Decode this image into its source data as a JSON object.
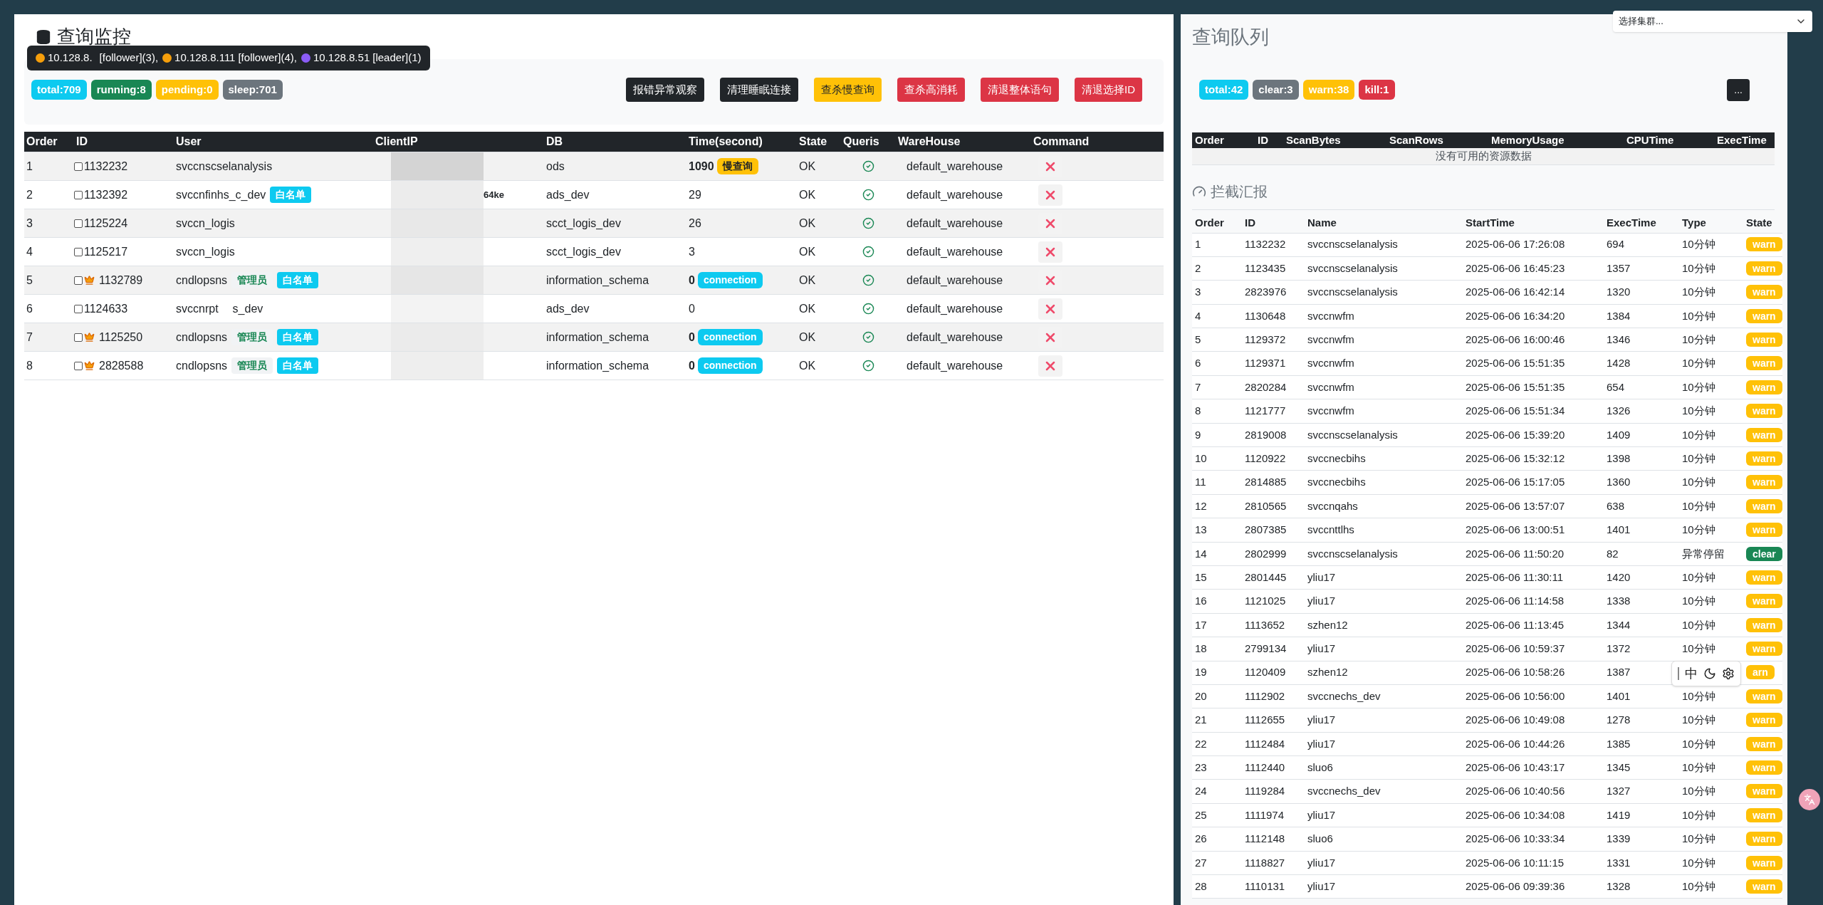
{
  "cluster_select": {
    "placeholder": "选择集群..."
  },
  "monitor": {
    "title": "查询监控",
    "tooltip": [
      {
        "host": "10.128.8.",
        "role": "[follower](3),",
        "color": "#f59e0b"
      },
      {
        "host": "10.128.8.111",
        "role": "[follower](4),",
        "color": "#f59e0b"
      },
      {
        "host": "10.128.8.51",
        "role": "[leader](1)",
        "color": "#8b5cf6"
      }
    ],
    "badges": [
      {
        "text": "total:709",
        "color": "#0dcaf0"
      },
      {
        "text": "running:8",
        "color": "#198754"
      },
      {
        "text": "pending:0",
        "color": "#ffc107"
      },
      {
        "text": "sleep:701",
        "color": "#6c757d"
      }
    ],
    "buttons": [
      {
        "label": "报错异常观察",
        "kind": "dark"
      },
      {
        "label": "清理睡眠连接",
        "kind": "dark"
      },
      {
        "label": "查杀慢查询",
        "kind": "warning"
      },
      {
        "label": "查杀高消耗",
        "kind": "danger"
      },
      {
        "label": "清退整体语句",
        "kind": "danger"
      },
      {
        "label": "清退选择ID",
        "kind": "danger"
      }
    ],
    "columns": [
      "Order",
      "ID",
      "User",
      "ClientIP",
      "DB",
      "Time(second)",
      "State",
      "Queris",
      "WareHouse",
      "Command"
    ],
    "rows": [
      {
        "order": "1",
        "id": "1132232",
        "checked": false,
        "crown": false,
        "user": "svccnscselanalysis",
        "tags": [],
        "ip_tail": "",
        "db": "ods",
        "time": "1090",
        "time_tag": {
          "text": "慢查询",
          "kind": "slow"
        },
        "state": "OK",
        "warehouse": "default_warehouse"
      },
      {
        "order": "2",
        "id": "1132392",
        "checked": false,
        "crown": false,
        "user": "svccnfinhs_c_dev",
        "tags": [
          {
            "text": "白名单",
            "kind": "whitelist"
          }
        ],
        "ip_tail": "64ke",
        "db": "ads_dev",
        "time": "29",
        "state": "OK",
        "warehouse": "default_warehouse"
      },
      {
        "order": "3",
        "id": "1125224",
        "checked": false,
        "crown": false,
        "user": "svccn_logis",
        "tags": [],
        "ip_tail": "",
        "db": "scct_logis_dev",
        "time": "26",
        "state": "OK",
        "warehouse": "default_warehouse"
      },
      {
        "order": "4",
        "id": "1125217",
        "checked": false,
        "crown": false,
        "user": "svccn_logis",
        "tags": [],
        "ip_tail": "",
        "db": "scct_logis_dev",
        "time": "3",
        "state": "OK",
        "warehouse": "default_warehouse"
      },
      {
        "order": "5",
        "id": "1132789",
        "checked": false,
        "crown": true,
        "user": "cndlopsns",
        "tags": [
          {
            "text": "管理员",
            "kind": "admin"
          },
          {
            "text": "白名单",
            "kind": "whitelist"
          }
        ],
        "ip_tail": "",
        "db": "information_schema",
        "time": "0",
        "time_tag": {
          "text": "connection",
          "kind": "connection"
        },
        "state": "OK",
        "warehouse": "default_warehouse"
      },
      {
        "order": "6",
        "id": "1124633",
        "checked": false,
        "crown": false,
        "user": "svccnrpt",
        "user_tail": "s_dev",
        "tags": [],
        "ip_tail": "",
        "db": "ads_dev",
        "time": "0",
        "state": "OK",
        "warehouse": "default_warehouse"
      },
      {
        "order": "7",
        "id": "1125250",
        "checked": false,
        "crown": true,
        "user": "cndlopsns",
        "tags": [
          {
            "text": "管理员",
            "kind": "admin"
          },
          {
            "text": "白名单",
            "kind": "whitelist"
          }
        ],
        "ip_tail": "",
        "db": "information_schema",
        "time": "0",
        "time_tag": {
          "text": "connection",
          "kind": "connection"
        },
        "state": "OK",
        "warehouse": "default_warehouse"
      },
      {
        "order": "8",
        "id": "2828588",
        "checked": false,
        "crown": true,
        "user": "cndlopsns",
        "tags": [
          {
            "text": "管理员",
            "kind": "admin"
          },
          {
            "text": "白名单",
            "kind": "whitelist"
          }
        ],
        "ip_tail": "",
        "db": "information_schema",
        "time": "0",
        "time_tag": {
          "text": "connection",
          "kind": "connection"
        },
        "state": "OK",
        "warehouse": "default_warehouse"
      }
    ]
  },
  "queue": {
    "title": "查询队列",
    "badges": [
      {
        "text": "total:42",
        "color": "#0dcaf0"
      },
      {
        "text": "clear:3",
        "color": "#6c757d"
      },
      {
        "text": "warn:38",
        "color": "#ffc107"
      },
      {
        "text": "kill:1",
        "color": "#dc3545"
      }
    ],
    "more_button": "...",
    "columns": [
      "Order",
      "ID",
      "ScanBytes",
      "ScanRows",
      "MemoryUsage",
      "CPUTime",
      "ExecTime"
    ],
    "empty_message": "没有可用的资源数据"
  },
  "report": {
    "title": "拦截汇报",
    "columns": [
      "Order",
      "ID",
      "Name",
      "StartTime",
      "ExecTime",
      "Type",
      "State"
    ],
    "rows": [
      {
        "order": "1",
        "id": "1132232",
        "name": "svccnscselanalysis",
        "start": "2025-06-06 17:26:08",
        "exec": "694",
        "type": "10分钟",
        "state": "warn",
        "kind": "warn"
      },
      {
        "order": "2",
        "id": "1123435",
        "name": "svccnscselanalysis",
        "start": "2025-06-06 16:45:23",
        "exec": "1357",
        "type": "10分钟",
        "state": "warn",
        "kind": "warn"
      },
      {
        "order": "3",
        "id": "2823976",
        "name": "svccnscselanalysis",
        "start": "2025-06-06 16:42:14",
        "exec": "1320",
        "type": "10分钟",
        "state": "warn",
        "kind": "warn"
      },
      {
        "order": "4",
        "id": "1130648",
        "name": "svccnwfm",
        "start": "2025-06-06 16:34:20",
        "exec": "1384",
        "type": "10分钟",
        "state": "warn",
        "kind": "warn"
      },
      {
        "order": "5",
        "id": "1129372",
        "name": "svccnwfm",
        "start": "2025-06-06 16:00:46",
        "exec": "1346",
        "type": "10分钟",
        "state": "warn",
        "kind": "warn"
      },
      {
        "order": "6",
        "id": "1129371",
        "name": "svccnwfm",
        "start": "2025-06-06 15:51:35",
        "exec": "1428",
        "type": "10分钟",
        "state": "warn",
        "kind": "warn"
      },
      {
        "order": "7",
        "id": "2820284",
        "name": "svccnwfm",
        "start": "2025-06-06 15:51:35",
        "exec": "654",
        "type": "10分钟",
        "state": "warn",
        "kind": "warn"
      },
      {
        "order": "8",
        "id": "1121777",
        "name": "svccnwfm",
        "start": "2025-06-06 15:51:34",
        "exec": "1326",
        "type": "10分钟",
        "state": "warn",
        "kind": "warn"
      },
      {
        "order": "9",
        "id": "2819008",
        "name": "svccnscselanalysis",
        "start": "2025-06-06 15:39:20",
        "exec": "1409",
        "type": "10分钟",
        "state": "warn",
        "kind": "warn"
      },
      {
        "order": "10",
        "id": "1120922",
        "name": "svccnecbihs",
        "start": "2025-06-06 15:32:12",
        "exec": "1398",
        "type": "10分钟",
        "state": "warn",
        "kind": "warn"
      },
      {
        "order": "11",
        "id": "2814885",
        "name": "svccnecbihs",
        "start": "2025-06-06 15:17:05",
        "exec": "1360",
        "type": "10分钟",
        "state": "warn",
        "kind": "warn"
      },
      {
        "order": "12",
        "id": "2810565",
        "name": "svccnqahs",
        "start": "2025-06-06 13:57:07",
        "exec": "638",
        "type": "10分钟",
        "state": "warn",
        "kind": "warn"
      },
      {
        "order": "13",
        "id": "2807385",
        "name": "svccnttlhs",
        "start": "2025-06-06 13:00:51",
        "exec": "1401",
        "type": "10分钟",
        "state": "warn",
        "kind": "warn"
      },
      {
        "order": "14",
        "id": "2802999",
        "name": "svccnscselanalysis",
        "start": "2025-06-06 11:50:20",
        "exec": "82",
        "type": "异常停留",
        "state": "clear",
        "kind": "clear"
      },
      {
        "order": "15",
        "id": "2801445",
        "name": "yliu17",
        "start": "2025-06-06 11:30:11",
        "exec": "1420",
        "type": "10分钟",
        "state": "warn",
        "kind": "warn"
      },
      {
        "order": "16",
        "id": "1121025",
        "name": "yliu17",
        "start": "2025-06-06 11:14:58",
        "exec": "1338",
        "type": "10分钟",
        "state": "warn",
        "kind": "warn"
      },
      {
        "order": "17",
        "id": "1113652",
        "name": "szhen12",
        "start": "2025-06-06 11:13:45",
        "exec": "1344",
        "type": "10分钟",
        "state": "warn",
        "kind": "warn"
      },
      {
        "order": "18",
        "id": "2799134",
        "name": "yliu17",
        "start": "2025-06-06 10:59:37",
        "exec": "1372",
        "type": "10分钟",
        "state": "warn",
        "kind": "warn"
      },
      {
        "order": "19",
        "id": "1120409",
        "name": "szhen12",
        "start": "2025-06-06 10:58:26",
        "exec": "1387",
        "state": "arn",
        "kind": "warn"
      },
      {
        "order": "20",
        "id": "1112902",
        "name": "svccnechs_dev",
        "start": "2025-06-06 10:56:00",
        "exec": "1401",
        "type": "10分钟",
        "state": "warn",
        "kind": "warn"
      },
      {
        "order": "21",
        "id": "1112655",
        "name": "yliu17",
        "start": "2025-06-06 10:49:08",
        "exec": "1278",
        "type": "10分钟",
        "state": "warn",
        "kind": "warn"
      },
      {
        "order": "22",
        "id": "1112484",
        "name": "yliu17",
        "start": "2025-06-06 10:44:26",
        "exec": "1385",
        "type": "10分钟",
        "state": "warn",
        "kind": "warn"
      },
      {
        "order": "23",
        "id": "1112440",
        "name": "sluo6",
        "start": "2025-06-06 10:43:17",
        "exec": "1345",
        "type": "10分钟",
        "state": "warn",
        "kind": "warn"
      },
      {
        "order": "24",
        "id": "1119284",
        "name": "svccnechs_dev",
        "start": "2025-06-06 10:40:56",
        "exec": "1327",
        "type": "10分钟",
        "state": "warn",
        "kind": "warn"
      },
      {
        "order": "25",
        "id": "1111974",
        "name": "yliu17",
        "start": "2025-06-06 10:34:08",
        "exec": "1419",
        "type": "10分钟",
        "state": "warn",
        "kind": "warn"
      },
      {
        "order": "26",
        "id": "1112148",
        "name": "sluo6",
        "start": "2025-06-06 10:33:34",
        "exec": "1339",
        "type": "10分钟",
        "state": "warn",
        "kind": "warn"
      },
      {
        "order": "27",
        "id": "1118827",
        "name": "yliu17",
        "start": "2025-06-06 10:11:15",
        "exec": "1331",
        "type": "10分钟",
        "state": "warn",
        "kind": "warn"
      },
      {
        "order": "28",
        "id": "1110131",
        "name": "yliu17",
        "start": "2025-06-06 09:39:36",
        "exec": "1328",
        "type": "10分钟",
        "state": "warn",
        "kind": "warn"
      }
    ]
  },
  "ime_toolbar": {
    "mode": "中"
  }
}
